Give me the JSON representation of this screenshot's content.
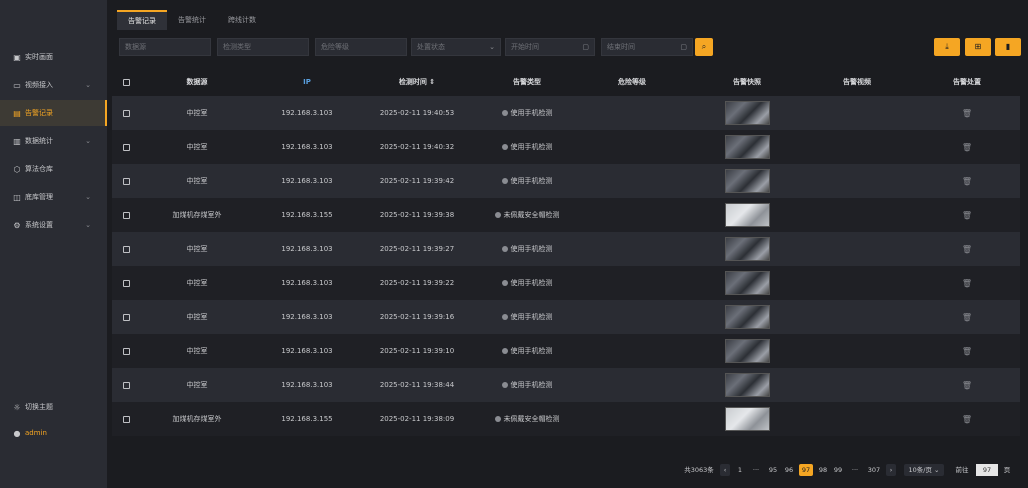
{
  "sidebar": {
    "items": [
      {
        "label": "实时画面",
        "icon": "monitor-icon"
      },
      {
        "label": "视频接入",
        "icon": "video-icon"
      },
      {
        "label": "告警记录",
        "icon": "document-icon"
      },
      {
        "label": "数据统计",
        "icon": "bar-chart-icon"
      },
      {
        "label": "算法仓库",
        "icon": "cube-icon"
      },
      {
        "label": "底库管理",
        "icon": "box-icon"
      },
      {
        "label": "系统设置",
        "icon": "gear-icon"
      }
    ],
    "theme_label": "切换主题",
    "user": "admin"
  },
  "tabs": [
    "告警记录",
    "告警统计",
    "跨线计数"
  ],
  "filters": {
    "source": "数据源",
    "detect_type": "检测类型",
    "risk_level": "危险等级",
    "status": "处置状态",
    "start_time": "开始时间",
    "end_time": "结束时间"
  },
  "table": {
    "headers": [
      "数据源",
      "IP",
      "检测时间 ⇕",
      "告警类型",
      "危险等级",
      "告警快照",
      "告警视频",
      "告警处置"
    ],
    "rows": [
      {
        "source": "中控室",
        "ip": "192.168.3.103",
        "time": "2025-02-11 19:40:53",
        "type": "使用手机检测",
        "thumb": "dark"
      },
      {
        "source": "中控室",
        "ip": "192.168.3.103",
        "time": "2025-02-11 19:40:32",
        "type": "使用手机检测",
        "thumb": "dark"
      },
      {
        "source": "中控室",
        "ip": "192.168.3.103",
        "time": "2025-02-11 19:39:42",
        "type": "使用手机检测",
        "thumb": "dark"
      },
      {
        "source": "加煤机存煤室外",
        "ip": "192.168.3.155",
        "time": "2025-02-11 19:39:38",
        "type": "未佩戴安全帽检测",
        "thumb": "light"
      },
      {
        "source": "中控室",
        "ip": "192.168.3.103",
        "time": "2025-02-11 19:39:27",
        "type": "使用手机检测",
        "thumb": "dark"
      },
      {
        "source": "中控室",
        "ip": "192.168.3.103",
        "time": "2025-02-11 19:39:22",
        "type": "使用手机检测",
        "thumb": "dark"
      },
      {
        "source": "中控室",
        "ip": "192.168.3.103",
        "time": "2025-02-11 19:39:16",
        "type": "使用手机检测",
        "thumb": "dark"
      },
      {
        "source": "中控室",
        "ip": "192.168.3.103",
        "time": "2025-02-11 19:39:10",
        "type": "使用手机检测",
        "thumb": "dark"
      },
      {
        "source": "中控室",
        "ip": "192.168.3.103",
        "time": "2025-02-11 19:38:44",
        "type": "使用手机检测",
        "thumb": "dark"
      },
      {
        "source": "加煤机存煤室外",
        "ip": "192.168.3.155",
        "time": "2025-02-11 19:38:09",
        "type": "未佩戴安全帽检测",
        "thumb": "light"
      }
    ]
  },
  "pagination": {
    "total": "共3063条",
    "pages": [
      "1",
      "···",
      "95",
      "96",
      "97",
      "98",
      "99",
      "···",
      "307"
    ],
    "current": "97",
    "page_size": "10条/页",
    "goto_label": "前往",
    "goto_value": "97",
    "goto_suffix": "页"
  },
  "colors": {
    "accent": "#f5a623",
    "bg": "#1b1c20",
    "sidebar": "#2a2c33"
  }
}
